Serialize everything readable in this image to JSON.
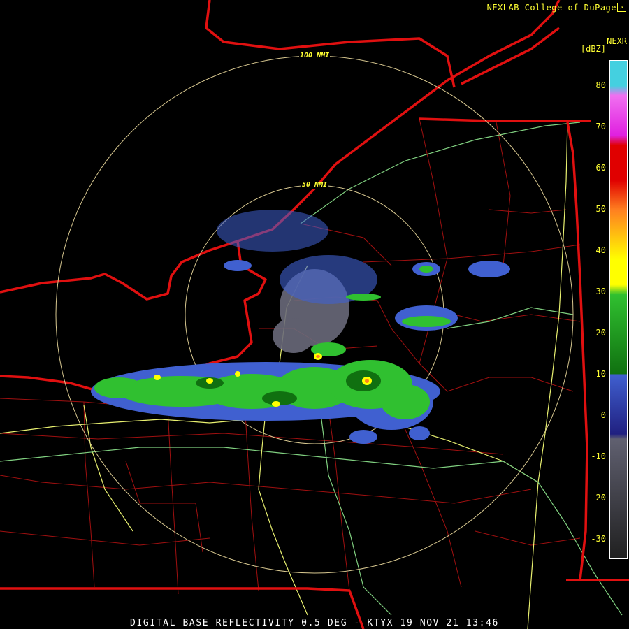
{
  "credit": "NEXLAB-College of DuPage",
  "credit_icon": "logo-icon",
  "product_label": "NEXR",
  "units": "[dBZ]",
  "rings": [
    {
      "label": "100 NMI"
    },
    {
      "label": "50 NMI"
    }
  ],
  "legend": {
    "ticks": [
      "80",
      "70",
      "60",
      "50",
      "40",
      "30",
      "20",
      "10",
      "0",
      "-10",
      "-20",
      "-30"
    ],
    "colors": {
      "cyan": "#44d0e0",
      "magenta": "#e020e0",
      "pink": "#f070f0",
      "red": "#e00000",
      "orange": "#ff8020",
      "yellow": "#ffff00",
      "green": "#30c030",
      "darkgreen": "#107010",
      "blue": "#4060d0",
      "navy": "#202080",
      "gray": "#606070",
      "dark": "#202020"
    }
  },
  "map_colors": {
    "state_border": "#e01010",
    "county_line": "#a01010",
    "highway_yellow": "#e8f070",
    "highway_green": "#80d080",
    "range_ring": "#d8c890"
  },
  "footer": "DIGITAL BASE REFLECTIVITY 0.5 DEG - KTYX 19 NOV 21 13:46"
}
